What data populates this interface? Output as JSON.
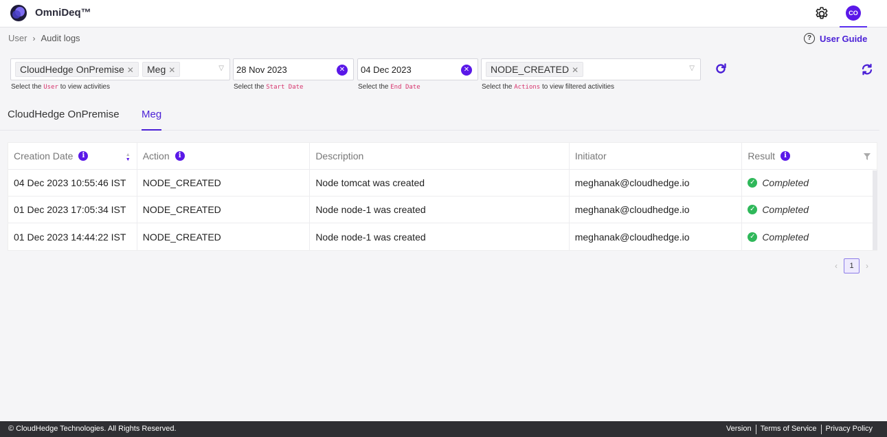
{
  "app": {
    "name": "OmniDeq™",
    "avatar_initials": "CO",
    "brand_color": "#5a18e8"
  },
  "breadcrumb": {
    "parent": "User",
    "current": "Audit logs"
  },
  "help": {
    "icon": "question-circle-icon",
    "label": "User Guide"
  },
  "filters": {
    "users": {
      "chips": [
        "CloudHedge OnPremise",
        "Meg"
      ],
      "hint_prefix": "Select the",
      "hint_code": "User",
      "hint_suffix": "to view activities"
    },
    "start_date": {
      "value": "28 Nov 2023",
      "hint_prefix": "Select the",
      "hint_code": "Start Date"
    },
    "end_date": {
      "value": "04 Dec 2023",
      "hint_prefix": "Select the",
      "hint_code": "End Date"
    },
    "actions": {
      "chips": [
        "NODE_CREATED"
      ],
      "hint_prefix": "Select the",
      "hint_code": "Actions",
      "hint_suffix": "to view filtered activities"
    }
  },
  "tabs": [
    {
      "label": "CloudHedge OnPremise",
      "active": false
    },
    {
      "label": "Meg",
      "active": true
    }
  ],
  "table": {
    "columns": [
      "Creation Date",
      "Action",
      "Description",
      "Initiator",
      "Result"
    ],
    "rows": [
      {
        "date": "04 Dec 2023 10:55:46 IST",
        "action": "NODE_CREATED",
        "description": "Node tomcat was created",
        "initiator": "meghanak@cloudhedge.io",
        "result": "Completed"
      },
      {
        "date": "01 Dec 2023 17:05:34 IST",
        "action": "NODE_CREATED",
        "description": "Node node-1 was created",
        "initiator": "meghanak@cloudhedge.io",
        "result": "Completed"
      },
      {
        "date": "01 Dec 2023 14:44:22 IST",
        "action": "NODE_CREATED",
        "description": "Node node-1 was created",
        "initiator": "meghanak@cloudhedge.io",
        "result": "Completed"
      }
    ]
  },
  "pagination": {
    "current_page": "1"
  },
  "footer": {
    "copyright": "© CloudHedge Technologies. All Rights Reserved.",
    "links": [
      "Version",
      "Terms of Service",
      "Privacy Policy"
    ]
  }
}
